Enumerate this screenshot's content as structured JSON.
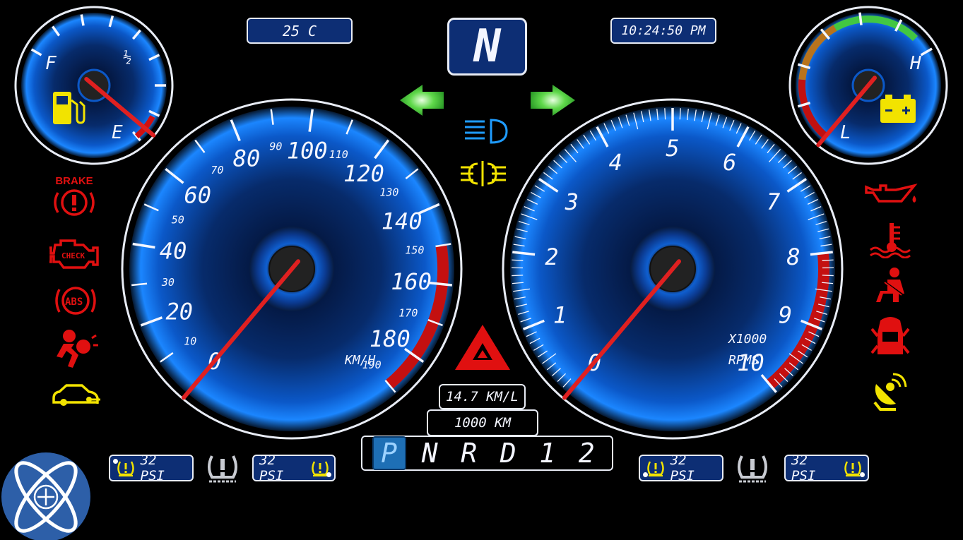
{
  "top": {
    "temperature": "25 C",
    "gear_indicator": "N",
    "clock": "10:24:50 PM"
  },
  "fuel_gauge": {
    "full_label": "F",
    "half_label": "½",
    "empty_label": "E",
    "level": 0.05
  },
  "temp_gauge": {
    "high_label": "H",
    "low_label": "L",
    "level": 0.08
  },
  "speedometer": {
    "unit_label": "KM/H",
    "major_labels": [
      "0",
      "20",
      "40",
      "60",
      "80",
      "100",
      "120",
      "140",
      "160",
      "180"
    ],
    "minor_labels": [
      "10",
      "30",
      "50",
      "70",
      "90",
      "110",
      "130",
      "150",
      "170",
      "190"
    ],
    "speed": 0,
    "max": 190
  },
  "tachometer": {
    "multiplier_label": "X1000",
    "unit_label": "RPMS",
    "labels": [
      "0",
      "1",
      "2",
      "3",
      "4",
      "5",
      "6",
      "7",
      "8",
      "9",
      "10"
    ],
    "rpm": 0
  },
  "trip": {
    "economy": "14.7 KM/L",
    "odometer": "1000 KM"
  },
  "gear_selector": {
    "gears": [
      "P",
      "N",
      "R",
      "D",
      "1",
      "2"
    ],
    "selected": "P"
  },
  "tire_pressure": {
    "front_left": "32 PSI",
    "front_right": "32 PSI",
    "rear_left": "32 PSI",
    "rear_right": "32 PSI"
  },
  "warnings_left": {
    "brake_label": "BRAKE",
    "check_label": "CHECK",
    "abs_label": "ABS"
  },
  "colors": {
    "accent_blue": "#1e8fff",
    "warning_red": "#e01010",
    "warning_yellow": "#f2e300",
    "indicator_green": "#3cc83c",
    "lcd_bg": "#0d2e74"
  }
}
